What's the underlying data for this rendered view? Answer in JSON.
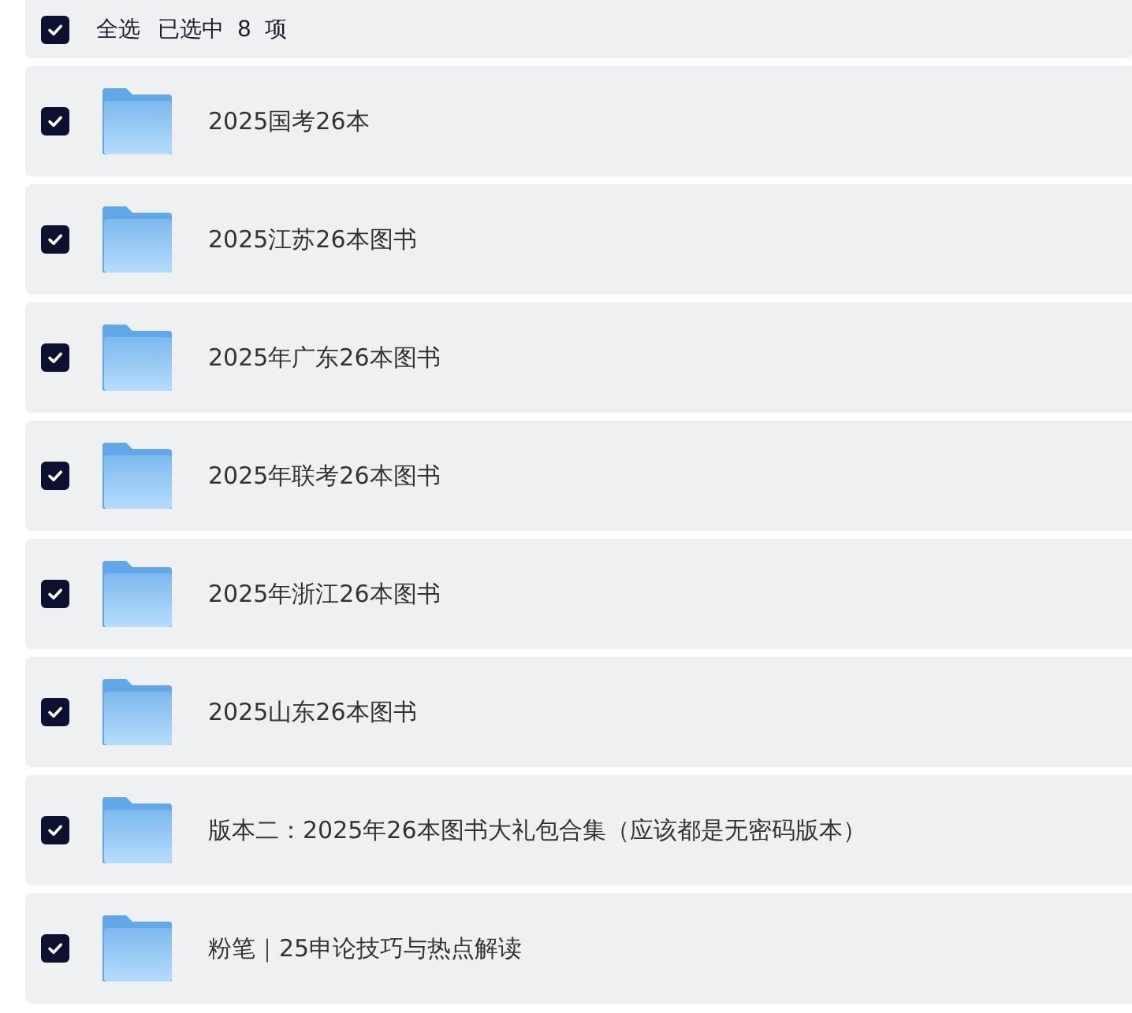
{
  "header": {
    "select_all": {
      "label": "全选",
      "checked": true
    },
    "selection_count": "已选中 8 项"
  },
  "items": [
    {
      "name": "2025国考26本",
      "checked": true
    },
    {
      "name": "2025江苏26本图书",
      "checked": true
    },
    {
      "name": "2025年广东26本图书",
      "checked": true
    },
    {
      "name": "2025年联考26本图书",
      "checked": true
    },
    {
      "name": "2025年浙江26本图书",
      "checked": true
    },
    {
      "name": "2025山东26本图书",
      "checked": true
    },
    {
      "name": "版本二：2025年26本图书大礼包合集（应该都是无密码版本）",
      "checked": true
    },
    {
      "name": "粉笔｜25申论技巧与热点解读",
      "checked": true
    }
  ]
}
